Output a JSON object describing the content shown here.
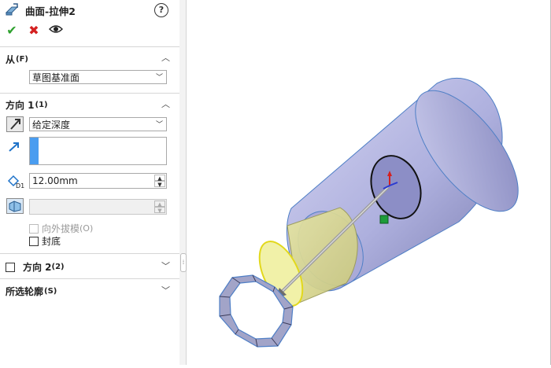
{
  "property_manager": {
    "title": "曲面-拉伸2",
    "help_icon": "?",
    "actions": {
      "ok_icon": "check-icon",
      "cancel_icon": "close-icon",
      "preview_icon": "eye-icon"
    }
  },
  "from_section": {
    "title": "从",
    "shortcut": "(F)",
    "start_condition": "草图基准面"
  },
  "direction1_section": {
    "title": "方向 1",
    "shortcut": "(1)",
    "end_condition": "给定深度",
    "depth_value": "12.00mm",
    "draft_label": "向外拔模",
    "draft_shortcut": "(O)",
    "cap_end_label": "封底"
  },
  "direction2_section": {
    "title": "方向 2",
    "shortcut": "(2)"
  },
  "selected_contours_section": {
    "title": "所选轮廓",
    "shortcut": "(S)"
  },
  "colors": {
    "accent_blue": "#4a9df0",
    "body_lavender": "#b9b9e6",
    "preview_yellow": "#eded9a",
    "ok_green": "#2ea12e",
    "cancel_red": "#d42020"
  }
}
